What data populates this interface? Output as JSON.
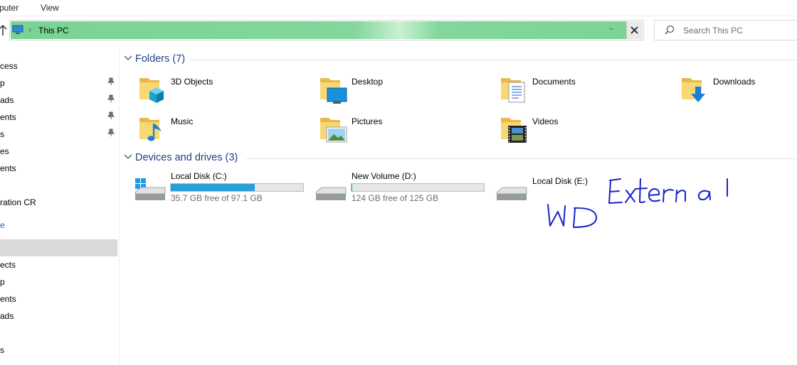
{
  "ribbon": {
    "tabs": [
      "puter",
      "View"
    ]
  },
  "address": {
    "chevron": "›",
    "location": "This PC",
    "dropdown": "⌄",
    "close": "✕"
  },
  "search": {
    "placeholder": "Search This PC"
  },
  "nav": {
    "items": [
      {
        "label": "cess",
        "pinned": false,
        "selected": false,
        "blue": false
      },
      {
        "label": "p",
        "pinned": true,
        "selected": false,
        "blue": false
      },
      {
        "label": "ads",
        "pinned": true,
        "selected": false,
        "blue": false
      },
      {
        "label": "ents",
        "pinned": true,
        "selected": false,
        "blue": false
      },
      {
        "label": "s",
        "pinned": true,
        "selected": false,
        "blue": false
      },
      {
        "label": "es",
        "pinned": false,
        "selected": false,
        "blue": false
      },
      {
        "label": "ents",
        "pinned": false,
        "selected": false,
        "blue": false
      },
      {
        "label": "ration CR",
        "pinned": false,
        "selected": false,
        "blue": false
      },
      {
        "label": "e",
        "pinned": false,
        "selected": false,
        "blue": true
      },
      {
        "label": "",
        "pinned": false,
        "selected": true,
        "blue": false
      },
      {
        "label": "ects",
        "pinned": false,
        "selected": false,
        "blue": false
      },
      {
        "label": "p",
        "pinned": false,
        "selected": false,
        "blue": false
      },
      {
        "label": "ents",
        "pinned": false,
        "selected": false,
        "blue": false
      },
      {
        "label": "ads",
        "pinned": false,
        "selected": false,
        "blue": false
      },
      {
        "label": "s",
        "pinned": false,
        "selected": false,
        "blue": false
      }
    ]
  },
  "folders": {
    "header": "Folders (7)",
    "items": [
      {
        "label": "3D Objects",
        "icon": "3d-objects-icon"
      },
      {
        "label": "Desktop",
        "icon": "desktop-folder-icon"
      },
      {
        "label": "Documents",
        "icon": "documents-folder-icon"
      },
      {
        "label": "Downloads",
        "icon": "downloads-folder-icon"
      },
      {
        "label": "Music",
        "icon": "music-folder-icon"
      },
      {
        "label": "Pictures",
        "icon": "pictures-folder-icon"
      },
      {
        "label": "Videos",
        "icon": "videos-folder-icon"
      }
    ]
  },
  "drives": {
    "header": "Devices and drives (3)",
    "items": [
      {
        "name": "Local Disk (C:)",
        "free": "35.7 GB free of 97.1 GB",
        "used_fraction": 0.632,
        "icon": "windows-drive-icon"
      },
      {
        "name": "New Volume (D:)",
        "free": "124 GB free of 125 GB",
        "used_fraction": 0.008,
        "icon": "hard-drive-icon"
      },
      {
        "name": "Local Disk (E:)",
        "free": "",
        "used_fraction": null,
        "icon": "hard-drive-icon"
      }
    ]
  },
  "annotation": {
    "line1": "External",
    "line2": "WD",
    "color": "#1a22c8"
  },
  "colors": {
    "accent": "#26a0da",
    "address_highlight": "#84d79c",
    "section_header": "#1e3f8a"
  }
}
